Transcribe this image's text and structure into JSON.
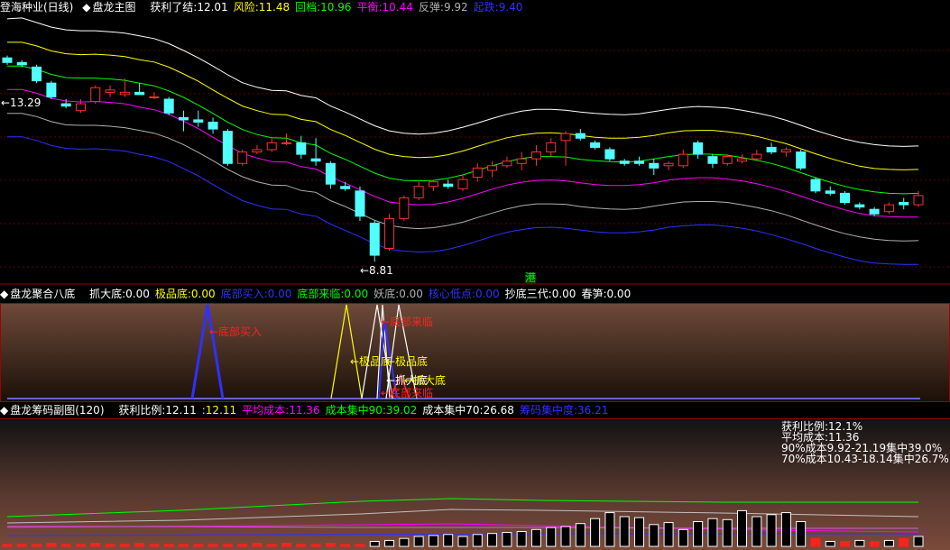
{
  "colors": {
    "white": "#ffffff",
    "yellow": "#ffff00",
    "green": "#00ff00",
    "magenta": "#ff00ff",
    "gray": "#b0b0b0",
    "blue": "#3030ff",
    "cyan": "#50ffff",
    "red": "#ff3030",
    "border": "#a00000",
    "grid": "#600000"
  },
  "main": {
    "title": "登海种业(日线)",
    "indicator": "盘龙主图",
    "fields": [
      {
        "label": "获利了结:",
        "value": "12.01",
        "color": "#ffffff"
      },
      {
        "label": "风险:",
        "value": "11.48",
        "color": "#ffff00"
      },
      {
        "label": "回档:",
        "value": "10.96",
        "color": "#00ff00"
      },
      {
        "label": "平衡:",
        "value": "10.44",
        "color": "#ff00ff"
      },
      {
        "label": "反弹:",
        "value": "9.92",
        "color": "#b0b0b0"
      },
      {
        "label": "起跌:",
        "value": "9.40",
        "color": "#3030ff"
      }
    ],
    "high_label": "←13.29",
    "low_label": "←8.81",
    "hk_label": "港"
  },
  "panel2": {
    "indicator": "盘龙聚合八底",
    "fields": [
      {
        "label": "抓大底:",
        "value": "0.00",
        "color": "#ffffff"
      },
      {
        "label": "极品底:",
        "value": "0.00",
        "color": "#ffff00"
      },
      {
        "label": "底部买入:",
        "value": "0.00",
        "color": "#3030ff"
      },
      {
        "label": "底部来临:",
        "value": "0.00",
        "color": "#00ff00"
      },
      {
        "label": "妖底:",
        "value": "0.00",
        "color": "#b0b0b0"
      },
      {
        "label": "核心低点:",
        "value": "0.00",
        "color": "#3030ff"
      },
      {
        "label": "抄底三代:",
        "value": "0.00",
        "color": "#ffffff"
      },
      {
        "label": "春笋:",
        "value": "0.00",
        "color": "#ffffff"
      }
    ],
    "annotations": [
      "←底部买入",
      "←底部来临",
      "←极品底",
      "←极品底",
      "←抓大底",
      "←底部来临",
      "←抓大底"
    ]
  },
  "panel3": {
    "indicator": "盘龙筹码副图(120)",
    "fields": [
      {
        "label": "获利比例:",
        "value": "12.11",
        "color": "#ffffff"
      },
      {
        "label": ":",
        "value": "12.11",
        "color": "#ffff00"
      },
      {
        "label": "平均成本:",
        "value": "11.36",
        "color": "#ff00ff"
      },
      {
        "label": "成本集中90:",
        "value": "39.02",
        "color": "#00ff00"
      },
      {
        "label": "成本集中70:",
        "value": "26.68",
        "color": "#ffffff"
      },
      {
        "label": "筹码集中度:",
        "value": "36.21",
        "color": "#3030ff"
      }
    ],
    "info_lines": [
      "获利比例:12.1%",
      "平均成本:11.36",
      "90%成本9.92-21.19集中39.0%",
      "70%成本10.43-18.14集中26.7%"
    ]
  },
  "chart_data": {
    "type": "candlestick",
    "ylim": [
      8.5,
      14.0
    ],
    "candles": [
      [
        13.25,
        13.3,
        13.1,
        13.15
      ],
      [
        13.15,
        13.2,
        13.05,
        13.1
      ],
      [
        13.05,
        13.1,
        12.7,
        12.75
      ],
      [
        12.7,
        12.75,
        12.35,
        12.4
      ],
      [
        12.25,
        12.35,
        12.15,
        12.2
      ],
      [
        12.1,
        12.35,
        12.05,
        12.25
      ],
      [
        12.3,
        12.65,
        12.25,
        12.6
      ],
      [
        12.5,
        12.65,
        12.4,
        12.55
      ],
      [
        12.45,
        12.8,
        12.4,
        12.5
      ],
      [
        12.5,
        12.7,
        12.45,
        12.45
      ],
      [
        12.4,
        12.5,
        12.35,
        12.4
      ],
      [
        12.35,
        12.4,
        12.0,
        12.05
      ],
      [
        11.95,
        12.1,
        11.65,
        11.9
      ],
      [
        11.9,
        12.1,
        11.75,
        11.85
      ],
      [
        11.85,
        11.95,
        11.6,
        11.7
      ],
      [
        11.65,
        11.7,
        10.9,
        10.95
      ],
      [
        10.95,
        11.25,
        10.9,
        11.2
      ],
      [
        11.2,
        11.35,
        11.15,
        11.25
      ],
      [
        11.25,
        11.5,
        11.2,
        11.4
      ],
      [
        11.4,
        11.6,
        11.35,
        11.4
      ],
      [
        11.4,
        11.55,
        11.05,
        11.15
      ],
      [
        11.05,
        11.5,
        10.9,
        11.0
      ],
      [
        10.95,
        11.0,
        10.4,
        10.5
      ],
      [
        10.45,
        10.55,
        10.35,
        10.4
      ],
      [
        10.35,
        10.45,
        9.7,
        9.8
      ],
      [
        9.65,
        9.7,
        8.81,
        8.95
      ],
      [
        9.1,
        9.85,
        9.05,
        9.75
      ],
      [
        9.75,
        10.25,
        9.7,
        10.2
      ],
      [
        10.2,
        10.55,
        10.15,
        10.45
      ],
      [
        10.45,
        10.6,
        10.35,
        10.55
      ],
      [
        10.5,
        10.6,
        10.4,
        10.45
      ],
      [
        10.4,
        10.7,
        10.35,
        10.6
      ],
      [
        10.65,
        10.95,
        10.55,
        10.85
      ],
      [
        10.8,
        11.0,
        10.65,
        10.9
      ],
      [
        10.9,
        11.1,
        10.85,
        11.0
      ],
      [
        10.95,
        11.2,
        10.8,
        11.05
      ],
      [
        11.05,
        11.35,
        10.9,
        11.2
      ],
      [
        11.2,
        11.5,
        11.1,
        11.4
      ],
      [
        11.45,
        11.65,
        10.9,
        11.6
      ],
      [
        11.6,
        11.7,
        11.45,
        11.5
      ],
      [
        11.4,
        11.45,
        11.25,
        11.3
      ],
      [
        11.25,
        11.3,
        11.0,
        11.05
      ],
      [
        11.0,
        11.05,
        10.9,
        10.95
      ],
      [
        11.0,
        11.1,
        10.9,
        10.95
      ],
      [
        10.95,
        11.05,
        10.7,
        10.85
      ],
      [
        10.9,
        11.0,
        10.8,
        10.95
      ],
      [
        10.9,
        11.25,
        10.85,
        11.15
      ],
      [
        11.4,
        11.45,
        11.05,
        11.15
      ],
      [
        11.1,
        11.15,
        10.85,
        10.95
      ],
      [
        10.95,
        11.15,
        10.9,
        11.1
      ],
      [
        11.0,
        11.15,
        10.95,
        11.05
      ],
      [
        11.05,
        11.25,
        11.0,
        11.15
      ],
      [
        11.3,
        11.4,
        11.15,
        11.2
      ],
      [
        11.2,
        11.3,
        11.1,
        11.25
      ],
      [
        11.2,
        11.25,
        10.8,
        10.85
      ],
      [
        10.6,
        10.65,
        10.3,
        10.35
      ],
      [
        10.35,
        10.45,
        10.25,
        10.3
      ],
      [
        10.3,
        10.35,
        10.05,
        10.1
      ],
      [
        10.05,
        10.1,
        9.95,
        10.0
      ],
      [
        9.95,
        10.0,
        9.8,
        9.85
      ],
      [
        9.9,
        10.1,
        9.85,
        10.05
      ],
      [
        10.1,
        10.2,
        9.95,
        10.05
      ],
      [
        10.05,
        10.35,
        10.0,
        10.25
      ]
    ],
    "bands": {
      "获利了结": [
        14.1,
        14.12,
        14.02,
        13.92,
        13.86,
        13.84,
        13.84,
        13.82,
        13.79,
        13.73,
        13.67,
        13.56,
        13.41,
        13.25,
        13.07,
        12.88,
        12.71,
        12.61,
        12.54,
        12.53,
        12.43,
        12.38,
        12.2,
        12.07,
        11.92,
        11.77,
        11.66,
        11.61,
        11.59,
        11.61,
        11.66,
        11.74,
        11.83,
        11.93,
        12.02,
        12.09,
        12.13,
        12.13,
        12.11,
        12.07,
        12.04,
        12.02,
        12.01,
        12.03,
        12.08,
        12.13,
        12.17,
        12.19,
        12.18,
        12.16,
        12.11,
        12.05,
        11.98,
        11.89,
        11.78,
        11.67,
        11.57,
        11.48,
        11.41,
        11.36,
        11.33,
        11.32,
        11.33
      ],
      "风险": [
        13.59,
        13.59,
        13.51,
        13.4,
        13.34,
        13.32,
        13.33,
        13.31,
        13.28,
        13.21,
        13.16,
        13.05,
        12.9,
        12.74,
        12.55,
        12.37,
        12.2,
        12.1,
        12.02,
        12.01,
        11.91,
        11.86,
        11.69,
        11.56,
        11.41,
        11.26,
        11.15,
        11.1,
        11.08,
        11.09,
        11.14,
        11.22,
        11.32,
        11.42,
        11.51,
        11.57,
        11.61,
        11.62,
        11.6,
        11.56,
        11.52,
        11.5,
        11.5,
        11.52,
        11.56,
        11.62,
        11.66,
        11.67,
        11.67,
        11.64,
        11.6,
        11.54,
        11.46,
        11.38,
        11.27,
        11.16,
        11.06,
        10.97,
        10.89,
        10.84,
        10.82,
        10.81,
        10.82
      ],
      "回档": [
        13.07,
        13.07,
        13.0,
        12.89,
        12.82,
        12.81,
        12.81,
        12.79,
        12.76,
        12.7,
        12.64,
        12.53,
        12.39,
        12.22,
        12.04,
        11.85,
        11.69,
        11.58,
        11.51,
        11.5,
        11.4,
        11.35,
        11.17,
        11.04,
        10.89,
        10.74,
        10.63,
        10.58,
        10.57,
        10.58,
        10.63,
        10.7,
        10.8,
        10.9,
        10.99,
        11.06,
        11.1,
        11.1,
        11.09,
        11.04,
        11.01,
        10.99,
        10.98,
        11.0,
        11.05,
        11.1,
        11.14,
        11.16,
        11.15,
        11.13,
        11.08,
        11.02,
        10.95,
        10.86,
        10.75,
        10.64,
        10.54,
        10.45,
        10.38,
        10.33,
        10.3,
        10.29,
        10.3
      ],
      "平衡": [
        12.56,
        12.56,
        12.48,
        12.37,
        12.31,
        12.29,
        12.3,
        12.28,
        12.25,
        12.18,
        12.12,
        12.02,
        11.87,
        11.71,
        11.52,
        11.34,
        11.17,
        11.07,
        10.99,
        10.98,
        10.88,
        10.83,
        10.66,
        10.52,
        10.38,
        10.23,
        10.11,
        10.07,
        10.05,
        10.06,
        10.11,
        10.19,
        10.29,
        10.39,
        10.48,
        10.54,
        10.58,
        10.59,
        10.57,
        10.53,
        10.49,
        10.47,
        10.47,
        10.49,
        10.53,
        10.59,
        10.62,
        10.64,
        10.64,
        10.61,
        10.57,
        10.51,
        10.43,
        10.34,
        10.24,
        10.13,
        10.03,
        9.94,
        9.86,
        9.81,
        9.79,
        9.78,
        9.78
      ],
      "反弹": [
        12.04,
        12.04,
        11.97,
        11.86,
        11.79,
        11.78,
        11.78,
        11.76,
        11.73,
        11.67,
        11.61,
        11.5,
        11.36,
        11.19,
        11.01,
        10.82,
        10.66,
        10.55,
        10.48,
        10.47,
        10.36,
        10.32,
        10.14,
        10.01,
        9.86,
        9.71,
        9.6,
        9.55,
        9.53,
        9.55,
        9.6,
        9.67,
        9.77,
        9.87,
        9.96,
        10.03,
        10.07,
        10.07,
        10.06,
        10.01,
        9.98,
        9.96,
        9.95,
        9.97,
        10.02,
        10.07,
        10.11,
        10.12,
        10.12,
        10.1,
        10.05,
        9.99,
        9.92,
        9.83,
        9.72,
        9.61,
        9.51,
        9.42,
        9.35,
        9.3,
        9.27,
        9.26,
        9.27
      ],
      "起跌": [
        11.53,
        11.53,
        11.45,
        11.34,
        11.28,
        11.26,
        11.27,
        11.25,
        11.22,
        11.15,
        11.09,
        10.99,
        10.84,
        10.68,
        10.49,
        10.31,
        10.14,
        10.04,
        9.96,
        9.95,
        9.85,
        9.8,
        9.63,
        9.49,
        9.35,
        9.2,
        9.08,
        9.04,
        9.02,
        9.03,
        9.08,
        9.16,
        9.26,
        9.36,
        9.45,
        9.51,
        9.55,
        9.56,
        9.54,
        9.5,
        9.46,
        9.44,
        9.44,
        9.46,
        9.5,
        9.56,
        9.59,
        9.61,
        9.61,
        9.58,
        9.54,
        9.48,
        9.4,
        9.31,
        9.21,
        9.1,
        9.0,
        8.91,
        8.83,
        8.78,
        8.76,
        8.75,
        8.75
      ]
    },
    "chip_volumes": [
      2,
      2,
      2,
      3,
      2,
      2,
      3,
      2,
      2,
      3,
      2,
      2,
      2,
      2,
      2,
      2,
      2,
      3,
      2,
      3,
      2,
      2,
      3,
      2,
      2,
      5,
      6,
      8,
      10,
      11,
      12,
      10,
      12,
      13,
      14,
      15,
      17,
      19,
      20,
      23,
      28,
      34,
      30,
      29,
      22,
      24,
      17,
      25,
      28,
      27,
      36,
      30,
      32,
      34,
      25,
      8,
      5,
      5,
      6,
      5,
      6,
      8,
      10
    ]
  }
}
